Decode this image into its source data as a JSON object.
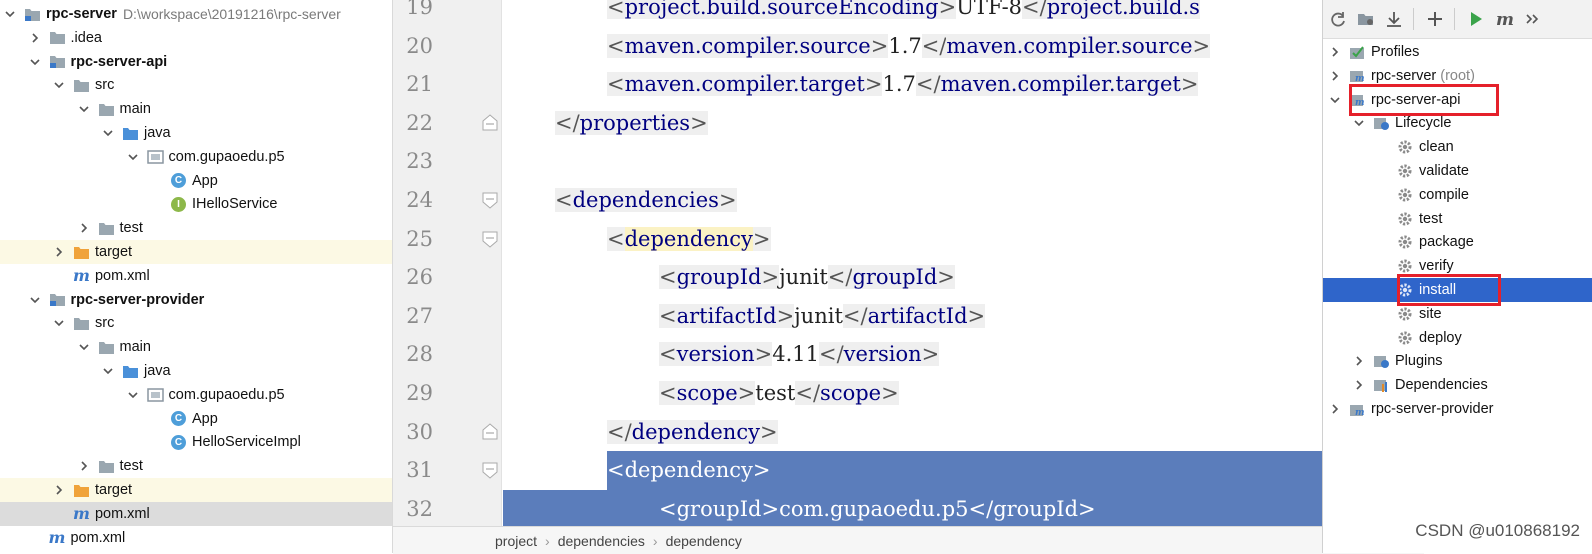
{
  "project_tree": {
    "rows": [
      {
        "indent": 0,
        "arrow": "down",
        "icon": "module-folder-icon",
        "label": "rpc-server",
        "bold": true,
        "path": "D:\\workspace\\20191216\\rpc-server"
      },
      {
        "indent": 1,
        "arrow": "right",
        "icon": "folder-icon",
        "label": ".idea"
      },
      {
        "indent": 1,
        "arrow": "down",
        "icon": "module-folder-icon",
        "label": "rpc-server-api",
        "bold": true
      },
      {
        "indent": 2,
        "arrow": "down",
        "icon": "folder-icon",
        "label": "src"
      },
      {
        "indent": 3,
        "arrow": "down",
        "icon": "folder-icon",
        "label": "main"
      },
      {
        "indent": 4,
        "arrow": "down",
        "icon": "source-folder-icon",
        "label": "java"
      },
      {
        "indent": 5,
        "arrow": "down",
        "icon": "package-icon",
        "label": "com.gupaoedu.p5"
      },
      {
        "indent": 6,
        "arrow": "none",
        "icon": "class-icon",
        "label": "App"
      },
      {
        "indent": 6,
        "arrow": "none",
        "icon": "interface-icon",
        "label": "IHelloService"
      },
      {
        "indent": 3,
        "arrow": "right",
        "icon": "folder-icon",
        "label": "test"
      },
      {
        "indent": 2,
        "arrow": "right",
        "icon": "excluded-folder-icon",
        "label": "target",
        "highlight": "yellow"
      },
      {
        "indent": 2,
        "arrow": "none",
        "icon": "maven-file-icon",
        "label": "pom.xml"
      },
      {
        "indent": 1,
        "arrow": "down",
        "icon": "module-folder-icon",
        "label": "rpc-server-provider",
        "bold": true
      },
      {
        "indent": 2,
        "arrow": "down",
        "icon": "folder-icon",
        "label": "src"
      },
      {
        "indent": 3,
        "arrow": "down",
        "icon": "folder-icon",
        "label": "main"
      },
      {
        "indent": 4,
        "arrow": "down",
        "icon": "source-folder-icon",
        "label": "java"
      },
      {
        "indent": 5,
        "arrow": "down",
        "icon": "package-icon",
        "label": "com.gupaoedu.p5"
      },
      {
        "indent": 6,
        "arrow": "none",
        "icon": "class-icon",
        "label": "App"
      },
      {
        "indent": 6,
        "arrow": "none",
        "icon": "class-icon",
        "label": "HelloServiceImpl"
      },
      {
        "indent": 3,
        "arrow": "right",
        "icon": "folder-icon",
        "label": "test"
      },
      {
        "indent": 2,
        "arrow": "right",
        "icon": "excluded-folder-icon",
        "label": "target",
        "highlight": "yellow"
      },
      {
        "indent": 2,
        "arrow": "none",
        "icon": "maven-file-icon",
        "label": "pom.xml",
        "highlight": "gray"
      },
      {
        "indent": 1,
        "arrow": "none",
        "icon": "maven-file-icon",
        "label": "pom.xml"
      }
    ]
  },
  "editor": {
    "lines": [
      {
        "num": "19",
        "indent": 2,
        "parts": [
          [
            "br",
            "<"
          ],
          [
            "tag",
            "project.build.sourceEncoding"
          ],
          [
            "br",
            ">"
          ],
          [
            "txt",
            "UTF-8"
          ],
          [
            "br",
            "</"
          ],
          [
            "tag",
            "project.build.s"
          ]
        ]
      },
      {
        "num": "20",
        "indent": 2,
        "parts": [
          [
            "br",
            "<"
          ],
          [
            "tag",
            "maven.compiler.source"
          ],
          [
            "br",
            ">"
          ],
          [
            "txt",
            "1.7"
          ],
          [
            "br",
            "</"
          ],
          [
            "tag",
            "maven.compiler.source"
          ],
          [
            "br",
            ">"
          ]
        ]
      },
      {
        "num": "21",
        "indent": 2,
        "parts": [
          [
            "br",
            "<"
          ],
          [
            "tag",
            "maven.compiler.target"
          ],
          [
            "br",
            ">"
          ],
          [
            "txt",
            "1.7"
          ],
          [
            "br",
            "</"
          ],
          [
            "tag",
            "maven.compiler.target"
          ],
          [
            "br",
            ">"
          ]
        ]
      },
      {
        "num": "22",
        "indent": 1,
        "fold": "end",
        "parts": [
          [
            "br",
            "</"
          ],
          [
            "tag",
            "properties"
          ],
          [
            "br",
            ">"
          ]
        ]
      },
      {
        "num": "23",
        "indent": 0,
        "parts": []
      },
      {
        "num": "24",
        "indent": 1,
        "fold": "start",
        "parts": [
          [
            "br",
            "<"
          ],
          [
            "tag",
            "dependencies"
          ],
          [
            "br",
            ">"
          ]
        ]
      },
      {
        "num": "25",
        "indent": 2,
        "fold": "start",
        "hl": true,
        "parts": [
          [
            "br",
            "<"
          ],
          [
            "tag",
            "dependency"
          ],
          [
            "br",
            ">"
          ]
        ]
      },
      {
        "num": "26",
        "indent": 3,
        "parts": [
          [
            "br",
            "<"
          ],
          [
            "tag",
            "groupId"
          ],
          [
            "br",
            ">"
          ],
          [
            "txt",
            "junit"
          ],
          [
            "br",
            "</"
          ],
          [
            "tag",
            "groupId"
          ],
          [
            "br",
            ">"
          ]
        ]
      },
      {
        "num": "27",
        "indent": 3,
        "parts": [
          [
            "br",
            "<"
          ],
          [
            "tag",
            "artifactId"
          ],
          [
            "br",
            ">"
          ],
          [
            "txt",
            "junit"
          ],
          [
            "br",
            "</"
          ],
          [
            "tag",
            "artifactId"
          ],
          [
            "br",
            ">"
          ]
        ]
      },
      {
        "num": "28",
        "indent": 3,
        "parts": [
          [
            "br",
            "<"
          ],
          [
            "tag",
            "version"
          ],
          [
            "br",
            ">"
          ],
          [
            "txt",
            "4.11"
          ],
          [
            "br",
            "</"
          ],
          [
            "tag",
            "version"
          ],
          [
            "br",
            ">"
          ]
        ]
      },
      {
        "num": "29",
        "indent": 3,
        "parts": [
          [
            "br",
            "<"
          ],
          [
            "tag",
            "scope"
          ],
          [
            "br",
            ">"
          ],
          [
            "txt",
            "test"
          ],
          [
            "br",
            "</"
          ],
          [
            "tag",
            "scope"
          ],
          [
            "br",
            ">"
          ]
        ]
      },
      {
        "num": "30",
        "indent": 2,
        "fold": "end",
        "parts": [
          [
            "br",
            "</"
          ],
          [
            "tag",
            "dependency"
          ],
          [
            "br",
            ">"
          ]
        ]
      },
      {
        "num": "31",
        "indent": 2,
        "fold": "start",
        "selected": true,
        "parts": [
          [
            "br",
            "<"
          ],
          [
            "tag",
            "dependency"
          ],
          [
            "br",
            ">"
          ]
        ]
      },
      {
        "num": "32",
        "indent": 3,
        "selected": true,
        "parts": [
          [
            "br",
            "<"
          ],
          [
            "tag",
            "groupId"
          ],
          [
            "br",
            ">"
          ],
          [
            "txt",
            "com.gupaoedu.p5"
          ],
          [
            "br",
            "</"
          ],
          [
            "tag",
            "groupId"
          ],
          [
            "br",
            ">"
          ]
        ]
      }
    ]
  },
  "breadcrumb": [
    "project",
    "dependencies",
    "dependency"
  ],
  "maven_panel": {
    "toolbar": [
      "reload-icon",
      "generate-sources-icon",
      "download-icon",
      "add-icon",
      "run-icon",
      "maven-goal-icon",
      "more-icon"
    ],
    "rows": [
      {
        "indent": 0,
        "arrow": "right",
        "icon": "profiles-icon",
        "label": "Profiles"
      },
      {
        "indent": 0,
        "arrow": "right",
        "icon": "maven-module-icon",
        "label": "rpc-server",
        "suffix": "(root)"
      },
      {
        "indent": 0,
        "arrow": "down",
        "icon": "maven-module-icon",
        "label": "rpc-server-api",
        "boxed": true
      },
      {
        "indent": 1,
        "arrow": "down",
        "icon": "lifecycle-icon",
        "label": "Lifecycle"
      },
      {
        "indent": 2,
        "arrow": "none",
        "icon": "gear-icon",
        "label": "clean"
      },
      {
        "indent": 2,
        "arrow": "none",
        "icon": "gear-icon",
        "label": "validate"
      },
      {
        "indent": 2,
        "arrow": "none",
        "icon": "gear-icon",
        "label": "compile"
      },
      {
        "indent": 2,
        "arrow": "none",
        "icon": "gear-icon",
        "label": "test"
      },
      {
        "indent": 2,
        "arrow": "none",
        "icon": "gear-icon",
        "label": "package"
      },
      {
        "indent": 2,
        "arrow": "none",
        "icon": "gear-icon",
        "label": "verify"
      },
      {
        "indent": 2,
        "arrow": "none",
        "icon": "gear-icon",
        "label": "install",
        "selected": true,
        "boxed": true
      },
      {
        "indent": 2,
        "arrow": "none",
        "icon": "gear-icon",
        "label": "site"
      },
      {
        "indent": 2,
        "arrow": "none",
        "icon": "gear-icon",
        "label": "deploy"
      },
      {
        "indent": 1,
        "arrow": "right",
        "icon": "plugins-icon",
        "label": "Plugins"
      },
      {
        "indent": 1,
        "arrow": "right",
        "icon": "dependencies-icon",
        "label": "Dependencies"
      },
      {
        "indent": 0,
        "arrow": "right",
        "icon": "maven-module-icon",
        "label": "rpc-server-provider"
      }
    ]
  },
  "watermark": "CSDN @u010868192",
  "colors": {
    "selection": "#5b7dbb",
    "maven_selected": "#2f65ca",
    "annotation_box": "#e5202a",
    "tag": "#000080"
  }
}
